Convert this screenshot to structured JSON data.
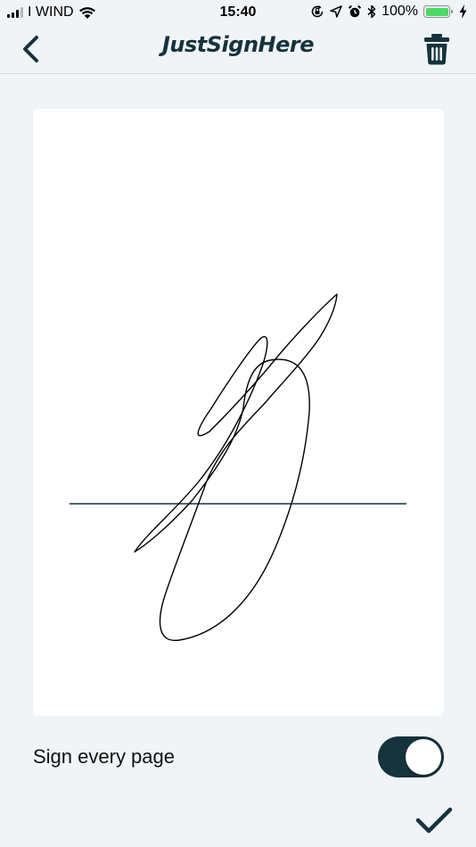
{
  "status_bar": {
    "carrier": "I WIND",
    "time": "15:40",
    "battery": "100%",
    "battery_level": 1.0,
    "icons": [
      "signal-icon",
      "wifi-icon",
      "orientation-lock-icon",
      "location-icon",
      "alarm-icon",
      "bluetooth-icon",
      "battery-icon",
      "charging-icon"
    ]
  },
  "nav": {
    "title": "JustSignHere",
    "back_icon": "chevron-left-icon",
    "delete_icon": "trash-icon"
  },
  "signature": {
    "baseline_color": "#15333c",
    "stroke_color": "#000000"
  },
  "options": {
    "sign_every_page_label": "Sign every page",
    "sign_every_page_on": true
  },
  "actions": {
    "confirm_icon": "checkmark-icon"
  },
  "colors": {
    "accent": "#15333c",
    "background": "#f1f4f7",
    "card": "#ffffff",
    "battery": "#4cd964"
  }
}
